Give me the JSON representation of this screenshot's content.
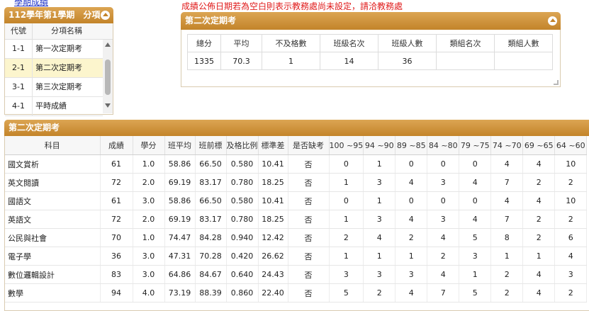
{
  "top_link": "學期成績",
  "notice": "成績公佈日期若為空白則表示教務處尚未設定，請洽教務處",
  "term_panel": {
    "title": "112學年第1學期　分項",
    "columns": [
      "代號",
      "分項名稱"
    ],
    "items": [
      {
        "code": "1-1",
        "name": "第一次定期考",
        "selected": false
      },
      {
        "code": "2-1",
        "name": "第二次定期考",
        "selected": true
      },
      {
        "code": "3-1",
        "name": "第三次定期考",
        "selected": false
      },
      {
        "code": "4-1",
        "name": "平時成績",
        "selected": false
      }
    ]
  },
  "summary_panel": {
    "title": "第二次定期考",
    "columns": [
      "總分",
      "平均",
      "不及格數",
      "班級名次",
      "班級人數",
      "類組名次",
      "類組人數"
    ],
    "values": [
      "1335",
      "70.3",
      "1",
      "14",
      "36",
      "",
      ""
    ]
  },
  "main_panel": {
    "title": "第二次定期考",
    "columns": [
      "科目",
      "成績",
      "學分",
      "班平均",
      "班前標",
      "及格比例",
      "標準差",
      "是否缺考",
      "100 ~95",
      "94 ~90",
      "89 ~85",
      "84 ~80",
      "79 ~75",
      "74 ~70",
      "69 ~65",
      "64 ~60"
    ],
    "rows": [
      [
        "國文賞析",
        "61",
        "1.0",
        "58.86",
        "66.50",
        "0.580",
        "10.41",
        "否",
        "0",
        "1",
        "0",
        "0",
        "0",
        "4",
        "4",
        "10"
      ],
      [
        "英文閱讀",
        "72",
        "2.0",
        "69.19",
        "83.17",
        "0.780",
        "18.25",
        "否",
        "1",
        "3",
        "4",
        "3",
        "4",
        "7",
        "2",
        "2"
      ],
      [
        "國語文",
        "61",
        "3.0",
        "58.86",
        "66.50",
        "0.580",
        "10.41",
        "否",
        "0",
        "1",
        "0",
        "0",
        "0",
        "4",
        "4",
        "10"
      ],
      [
        "英語文",
        "72",
        "2.0",
        "69.19",
        "83.17",
        "0.780",
        "18.25",
        "否",
        "1",
        "3",
        "4",
        "3",
        "4",
        "7",
        "2",
        "2"
      ],
      [
        "公民與社會",
        "70",
        "1.0",
        "74.47",
        "84.28",
        "0.940",
        "12.42",
        "否",
        "2",
        "4",
        "2",
        "4",
        "5",
        "8",
        "2",
        "6"
      ],
      [
        "電子學",
        "36",
        "3.0",
        "47.31",
        "70.28",
        "0.420",
        "26.62",
        "否",
        "1",
        "1",
        "1",
        "2",
        "3",
        "1",
        "1",
        "4"
      ],
      [
        "數位邏輯設計",
        "83",
        "3.0",
        "64.86",
        "84.67",
        "0.640",
        "24.43",
        "否",
        "3",
        "3",
        "3",
        "4",
        "1",
        "2",
        "4",
        "3"
      ],
      [
        "數學",
        "94",
        "4.0",
        "73.19",
        "88.39",
        "0.860",
        "22.40",
        "否",
        "5",
        "2",
        "4",
        "7",
        "5",
        "2",
        "4",
        "2"
      ]
    ]
  }
}
